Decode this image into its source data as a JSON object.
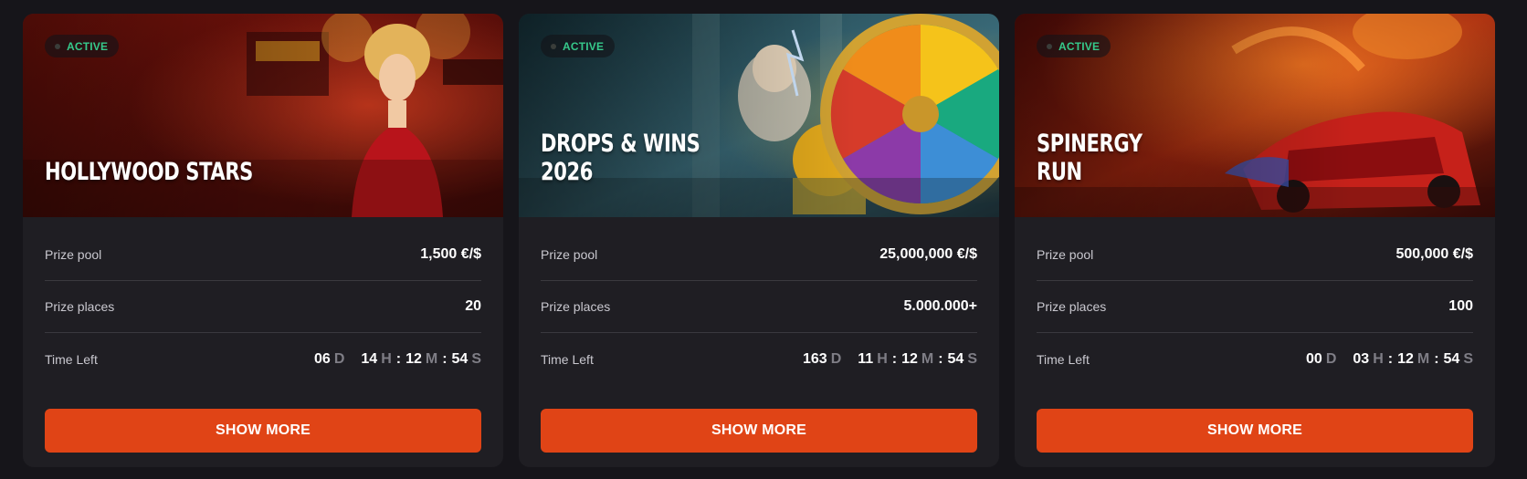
{
  "cards": [
    {
      "status": "ACTIVE",
      "title_line1": "HOLLYWOOD STARS",
      "title_line2": "",
      "prize_pool_label": "Prize pool",
      "prize_pool": "1,500 €/$",
      "prize_places_label": "Prize places",
      "prize_places": "20",
      "time_left_label": "Time Left",
      "timer": {
        "days": "06",
        "d": "D",
        "hours": "14",
        "h": "H",
        "minutes": "12",
        "m": "M",
        "seconds": "54",
        "s": "S"
      },
      "button": "SHOW MORE",
      "colors": {
        "bg1": "#7a0f0a",
        "bg2": "#c02815",
        "bg3": "#2a0b08"
      }
    },
    {
      "status": "ACTIVE",
      "title_line1": "DROPS & WINS",
      "title_line2": "2026",
      "prize_pool_label": "Prize pool",
      "prize_pool": "25,000,000 €/$",
      "prize_places_label": "Prize places",
      "prize_places": "5.000.000+",
      "time_left_label": "Time Left",
      "timer": {
        "days": "163",
        "d": "D",
        "hours": "11",
        "h": "H",
        "minutes": "12",
        "m": "M",
        "seconds": "54",
        "s": "S"
      },
      "button": "SHOW MORE",
      "colors": {
        "bg1": "#12303a",
        "bg2": "#2d6472",
        "bg3": "#0d1f26"
      }
    },
    {
      "status": "ACTIVE",
      "title_line1": "SPINERGY",
      "title_line2": "RUN",
      "prize_pool_label": "Prize pool",
      "prize_pool": "500,000 €/$",
      "prize_places_label": "Prize places",
      "prize_places": "100",
      "time_left_label": "Time Left",
      "timer": {
        "days": "00",
        "d": "D",
        "hours": "03",
        "h": "H",
        "minutes": "12",
        "m": "M",
        "seconds": "54",
        "s": "S"
      },
      "button": "SHOW MORE",
      "colors": {
        "bg1": "#5a0c08",
        "bg2": "#d0461a",
        "bg3": "#1e0806"
      }
    }
  ]
}
